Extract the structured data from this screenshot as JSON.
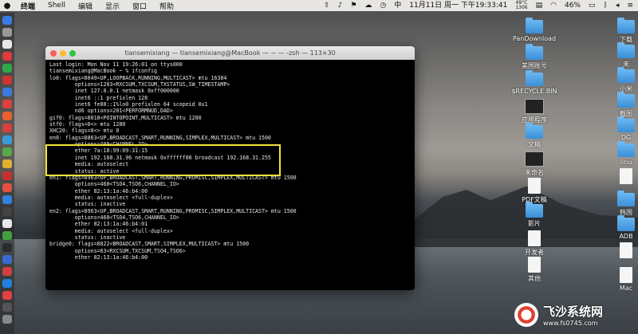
{
  "menubar": {
    "apple": "",
    "items": [
      "终端",
      "Shell",
      "编辑",
      "显示",
      "窗口",
      "帮助"
    ],
    "cpu_temp": "49°C",
    "cpu_label": "1306",
    "cn_label": "中",
    "clock": "11月11日 周一 下午19:33:41",
    "battery": "46%"
  },
  "terminal": {
    "title": "tiansemixiang — tiansemixiang@MacBook — ~ — -zsh — 113×30",
    "lines": [
      "Last login: Mon Nov 11 19:26:01 on ttys000",
      "tiansemixiang@MacBook ~ % ifconfig",
      "lo0: flags=8049<UP,LOOPBACK,RUNNING,MULTICAST> mtu 16384",
      "        options=1203<RXCSUM,TXCSUM,TXSTATUS,SW_TIMESTAMP>",
      "        inet 127.0.0.1 netmask 0xff000000",
      "        inet6 ::1 prefixlen 128",
      "        inet6 fe80::1%lo0 prefixlen 64 scopeid 0x1",
      "        nd6 options=201<PERFORMNUD,DAD>",
      "gif0: flags=8010<POINTOPOINT,MULTICAST> mtu 1280",
      "stf0: flags=0<> mtu 1280",
      "XHC20: flags=0<> mtu 0",
      "en0: flags=8863<UP,BROADCAST,SMART,RUNNING,SIMPLEX,MULTICAST> mtu 1500",
      "        options=400<CHANNEL_IO>",
      "        ether 7a:18:99:09:31:15",
      "        inet 192.168.31.96 netmask 0xffffff00 broadcast 192.168.31.255",
      "        media: autoselect",
      "        status: active",
      "en1: flags=8963<UP,BROADCAST,SMART,RUNNING,PROMISC,SIMPLEX,MULTICAST> mtu 1500",
      "        options=460<TSO4,TSO6,CHANNEL_IO>",
      "        ether 82:13:1a:46:b4:00",
      "        media: autoselect <full-duplex>",
      "        status: inactive",
      "en2: flags=8963<UP,BROADCAST,SMART,RUNNING,PROMISC,SIMPLEX,MULTICAST> mtu 1500",
      "        options=460<TSO4,TSO6,CHANNEL_IO>",
      "        ether 82:13:1a:46:b4:01",
      "        media: autoselect <full-duplex>",
      "        status: inactive",
      "bridge0: flags=8822<BROADCAST,SMART,SIMPLEX,MULTICAST> mtu 1500",
      "        options=63<RXCSUM,TXCSUM,TSO4,TSO6>",
      "        ether 82:13:1a:46:b4:00"
    ]
  },
  "desktop": {
    "icons_col1": [
      {
        "label": "PanDownload",
        "kind": "folder"
      },
      {
        "label": "美国账号",
        "kind": "folder"
      },
      {
        "label": "$RECYCLE.BIN",
        "kind": "folder"
      },
      {
        "label": "应用程序",
        "kind": "dark"
      },
      {
        "label": "文稿",
        "kind": "folder"
      },
      {
        "label": "未命名",
        "kind": "dark"
      },
      {
        "label": "PDF文稿",
        "kind": "doc"
      },
      {
        "label": "影片",
        "kind": "folder"
      },
      {
        "label": "开发者",
        "kind": "doc"
      },
      {
        "label": "其他",
        "kind": "doc"
      }
    ],
    "icons_col2": [
      {
        "label": "下载",
        "kind": "folder"
      },
      {
        "label": "未",
        "kind": "folder"
      },
      {
        "label": "小米",
        "kind": "folder"
      },
      {
        "label": "截图",
        "kind": "folder"
      },
      {
        "label": "DG",
        "kind": "folder"
      },
      {
        "label": "linu",
        "kind": "folder"
      },
      {
        "label": "",
        "kind": "doc"
      },
      {
        "label": "韩国",
        "kind": "folder"
      },
      {
        "label": "ADB",
        "kind": "folder"
      },
      {
        "label": "",
        "kind": "doc"
      },
      {
        "label": "Mac",
        "kind": "doc"
      }
    ]
  },
  "watermark": {
    "name": "飞沙系统网",
    "url": "www.fs0745.com"
  }
}
